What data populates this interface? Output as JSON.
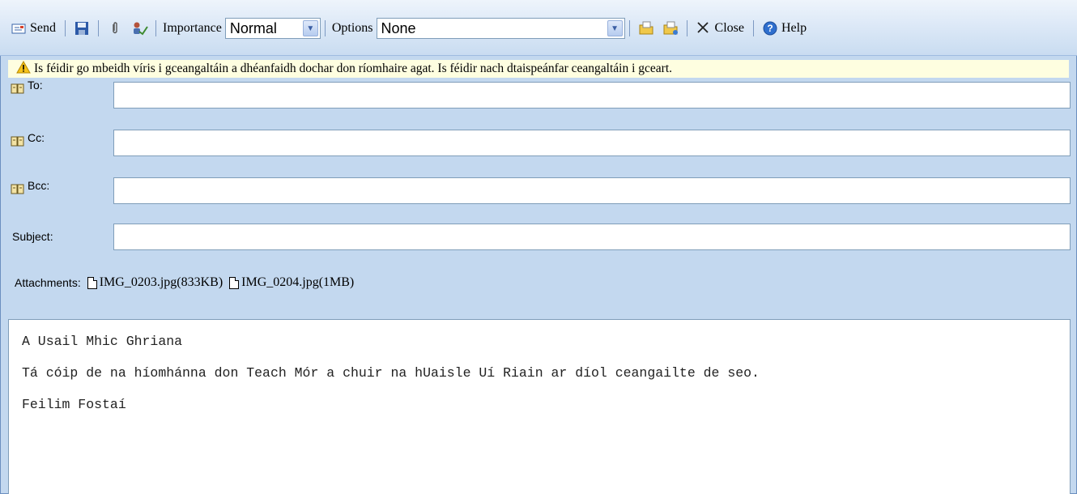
{
  "toolbar": {
    "send_label": "Send",
    "importance_label": "Importance",
    "importance_value": "Normal",
    "options_label": "Options",
    "options_value": "None",
    "close_label": "Close",
    "help_label": "Help"
  },
  "warning": {
    "text": "Is féidir go mbeidh víris i gceangaltáin a dhéanfaidh dochar don ríomhaire agat.  Is féidir nach dtaispeánfar ceangaltáin i gceart."
  },
  "fields": {
    "to_label": "To:",
    "cc_label": "Cc:",
    "bcc_label": "Bcc:",
    "subject_label": "Subject:",
    "to_value": "",
    "cc_value": "",
    "bcc_value": "",
    "subject_value": ""
  },
  "attachments": {
    "label": "Attachments:",
    "items": [
      {
        "name": "IMG_0203.jpg(833KB)"
      },
      {
        "name": "IMG_0204.jpg(1MB)"
      }
    ]
  },
  "body": {
    "lines": [
      "A Usail Mhic Ghriana",
      "Tá cóip de na híomhánna don Teach Mór a chuir na hUaisle Uí Riain ar díol ceangailte de seo.",
      "Feilim Fostaí"
    ]
  }
}
